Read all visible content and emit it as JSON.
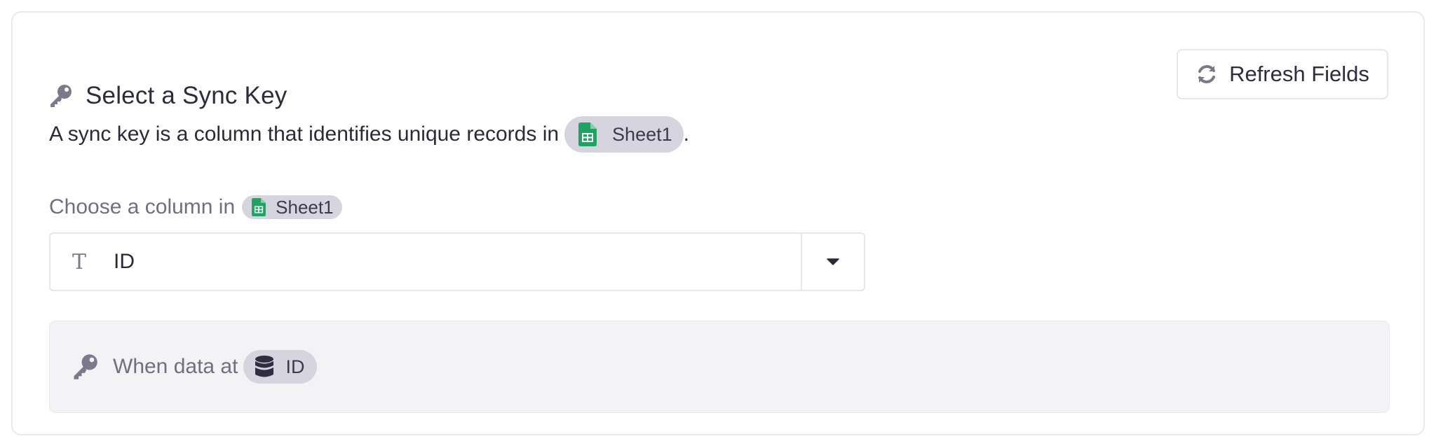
{
  "header": {
    "title": "Select a Sync Key",
    "title_icon": "key-icon",
    "refresh_label": "Refresh Fields",
    "refresh_icon": "refresh-icon"
  },
  "description": {
    "text": "A sync key is a column that identifies unique records in",
    "sheet_name": "Sheet1",
    "sheet_icon": "google-sheets-icon",
    "trailing": "."
  },
  "column_picker": {
    "label": "Choose a column in",
    "sheet_name": "Sheet1",
    "sheet_icon": "google-sheets-icon",
    "selected_value": "ID",
    "type_icon": "T",
    "type_icon_name": "text-type-icon",
    "caret_icon": "caret-down-icon"
  },
  "info": {
    "text": "When data at",
    "field_name": "ID",
    "field_icon": "database-icon",
    "icon": "key-icon"
  },
  "colors": {
    "sheets_green": "#1ea362",
    "pill_bg": "#d6d5df",
    "info_bg": "#f3f3f6",
    "muted_text": "#6f6f82",
    "icon_gray": "#7a7a8c"
  }
}
